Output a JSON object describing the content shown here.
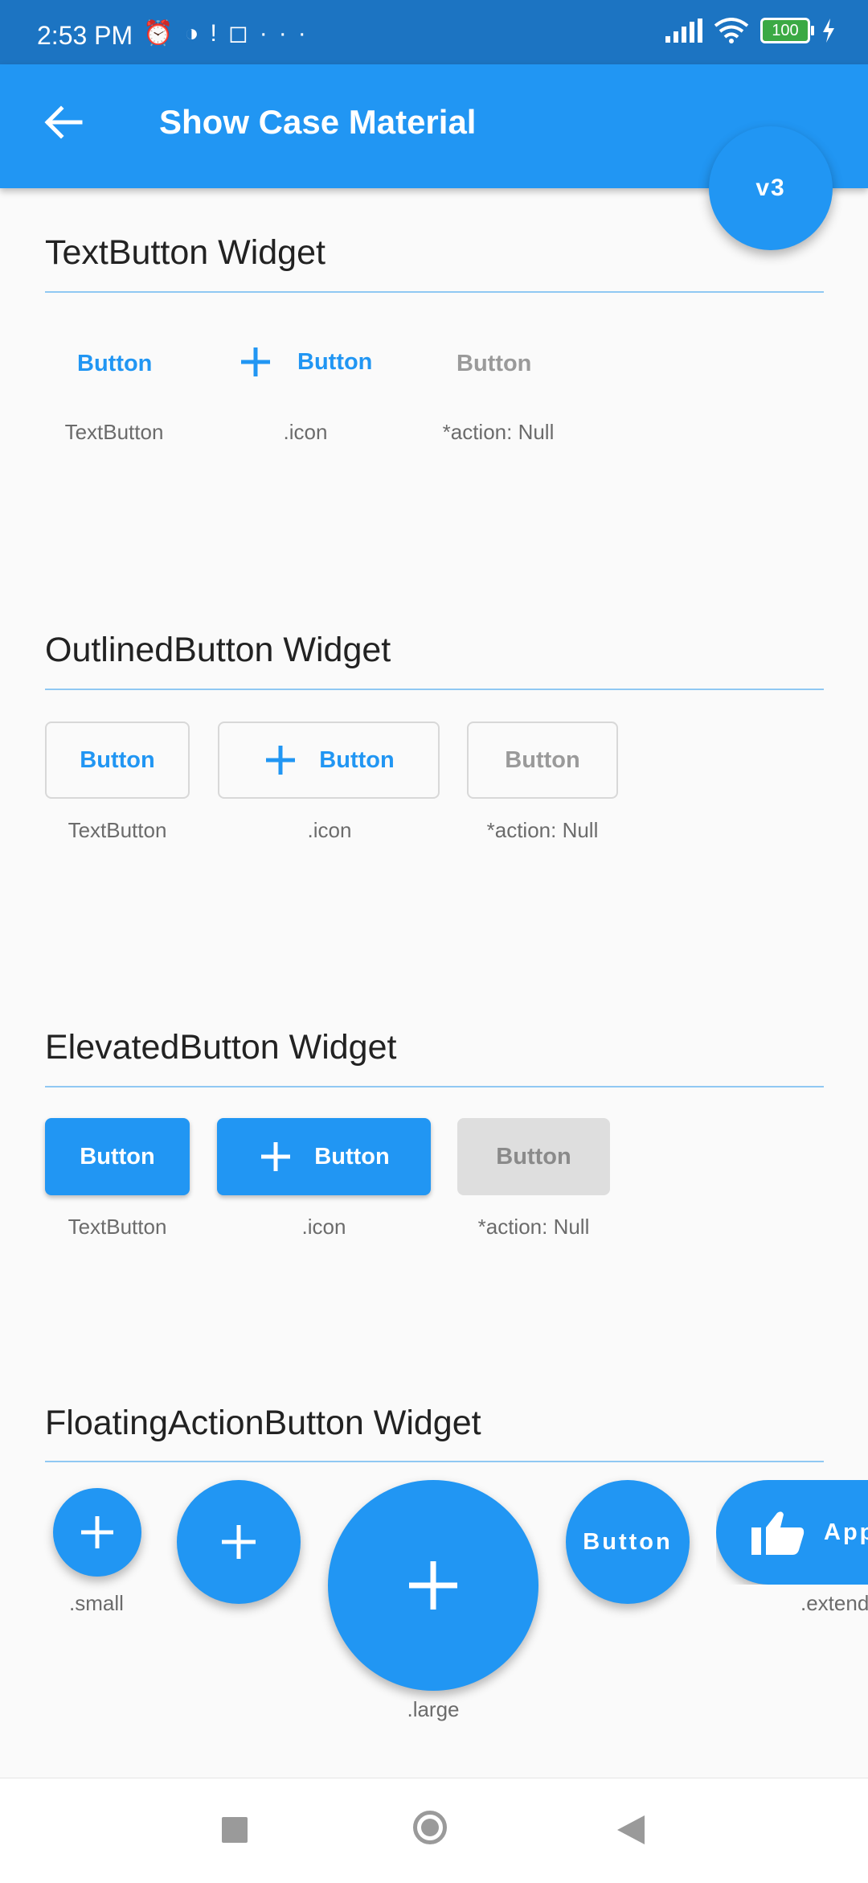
{
  "status_bar": {
    "time": "2:53 PM",
    "icons": [
      "alarm-icon",
      "app-icon",
      "alert-icon",
      "instagram-icon",
      "more-icon"
    ],
    "battery": "100"
  },
  "app_bar": {
    "title": "Show Case Material",
    "version_label": "v3"
  },
  "text_button_section": {
    "title": "TextButton Widget",
    "buttons": [
      {
        "label": "Button",
        "caption": "TextButton"
      },
      {
        "label": "Button",
        "caption": ".icon"
      },
      {
        "label": "Button",
        "caption": "*action: Null"
      }
    ]
  },
  "outlined_button_section": {
    "title": "OutlinedButton Widget",
    "buttons": [
      {
        "label": "Button",
        "caption": "TextButton"
      },
      {
        "label": "Button",
        "caption": ".icon"
      },
      {
        "label": "Button",
        "caption": "*action: Null"
      }
    ]
  },
  "elevated_button_section": {
    "title": "ElevatedButton Widget",
    "buttons": [
      {
        "label": "Button",
        "caption": "TextButton"
      },
      {
        "label": "Button",
        "caption": ".icon"
      },
      {
        "label": "Button",
        "caption": "*action: Null"
      }
    ]
  },
  "fab_section": {
    "title": "FloatingActionButton Widget",
    "small_caption": ".small",
    "large_caption": ".large",
    "text_fab_label": "Button",
    "extended_label": "App",
    "extended_caption": ".extend"
  },
  "colors": {
    "primary": "#2196f3",
    "status_bar": "#1c74c2",
    "disabled_text": "#9a9a9a",
    "disabled_bg": "#dedede"
  }
}
